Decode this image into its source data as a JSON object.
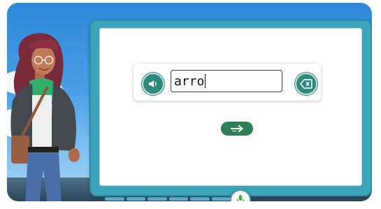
{
  "word_input": {
    "value": "arro"
  },
  "icons": {
    "speaker": "speaker-icon",
    "backspace": "backspace-icon",
    "next": "arrow-right-icon",
    "mic": "microphone-icon"
  },
  "colors": {
    "board": "#3da3b8",
    "teal_button": "#2e8a7d",
    "next_button": "#2e7f55",
    "mic": "#4fae4a"
  }
}
